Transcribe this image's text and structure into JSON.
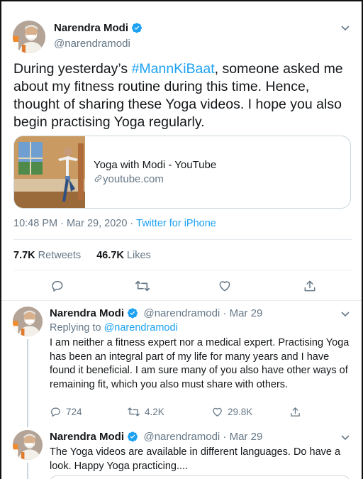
{
  "main_tweet": {
    "author_name": "Narendra Modi",
    "author_handle": "@narendramodi",
    "text_before": "During yesterday’s ",
    "hashtag": "#MannKiBaat",
    "text_after": ", someone asked me about my fitness routine during this time. Hence, thought of sharing these Yoga videos.  I hope you also begin practising Yoga regularly.",
    "card": {
      "title": "Yoga with Modi - YouTube",
      "domain": "youtube.com"
    },
    "timestamp": "10:48 PM · Mar 29, 2020 · ",
    "source": "Twitter for iPhone",
    "retweets_count": "7.7K",
    "retweets_label": " Retweets",
    "likes_count": "46.7K",
    "likes_label": " Likes"
  },
  "replies": [
    {
      "author_name": "Narendra Modi",
      "author_handle": "@narendramodi",
      "date": " · Mar 29",
      "replying_prefix": "Replying to ",
      "replying_handle": "@narendramodi",
      "text": "I am neither a fitness expert nor a medical expert. Practising Yoga has been an integral part of my life for many years and I have found it beneficial. I am sure many of you also have other ways of remaining fit, which you also must share with others.",
      "reply_count": "724",
      "retweet_count": "4.2K",
      "like_count": "29.8K"
    },
    {
      "author_name": "Narendra Modi",
      "author_handle": "@narendramodi",
      "date": " · Mar 29",
      "text": "The Yoga videos are available in different languages. Do have a look. Happy Yoga practicing...."
    }
  ],
  "icons": {
    "verified": "verified-badge-icon",
    "chevron": "chevron-down-icon",
    "reply": "reply-icon",
    "retweet": "retweet-icon",
    "like": "heart-icon",
    "share": "share-icon",
    "link": "link-icon"
  },
  "colors": {
    "accent": "#1da1f2",
    "text": "#14171a",
    "muted": "#657786",
    "border": "#e6ecf0"
  }
}
